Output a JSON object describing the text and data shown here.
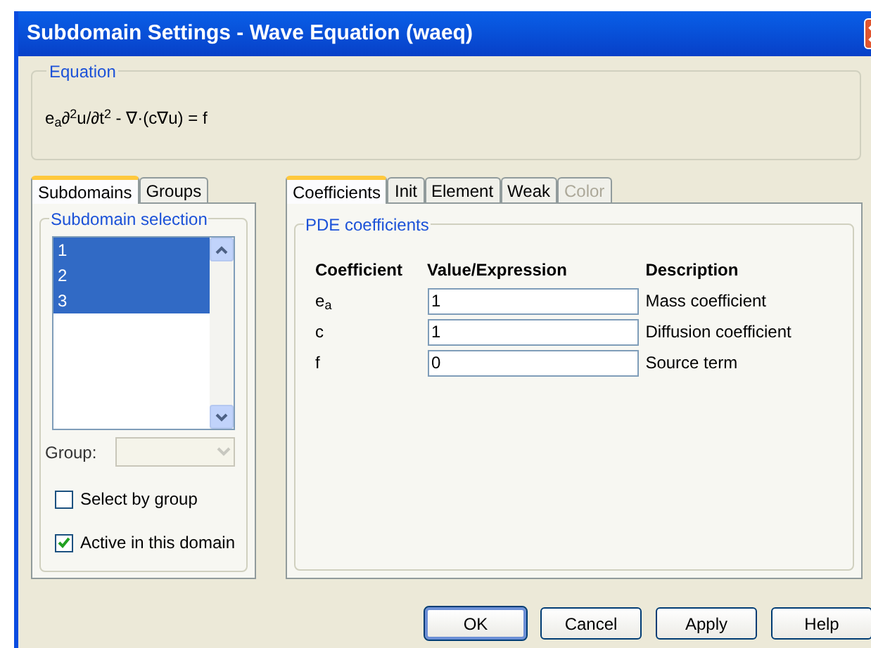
{
  "window": {
    "title": "Subdomain Settings - Wave Equation (waeq)"
  },
  "equation": {
    "label": "Equation",
    "text": "e$_{a}$∂$^{2}$u/∂t$^{2}$ - ∇·(c∇u) = f"
  },
  "left_tabs": [
    {
      "label": "Subdomains",
      "selected": true
    },
    {
      "label": "Groups",
      "selected": false
    }
  ],
  "subdomain_selection": {
    "label": "Subdomain selection",
    "items": [
      {
        "label": "1",
        "selected": true
      },
      {
        "label": "2",
        "selected": true
      },
      {
        "label": "3",
        "selected": true
      }
    ]
  },
  "group": {
    "label": "Group:",
    "disabled": true
  },
  "checkboxes": [
    {
      "label": "Select by group",
      "checked": false
    },
    {
      "label": "Active in this domain",
      "checked": true
    }
  ],
  "right_tabs": [
    {
      "label": "Coefficients",
      "selected": true,
      "disabled": false
    },
    {
      "label": "Init",
      "selected": false,
      "disabled": false
    },
    {
      "label": "Element",
      "selected": false,
      "disabled": false
    },
    {
      "label": "Weak",
      "selected": false,
      "disabled": false
    },
    {
      "label": "Color",
      "selected": false,
      "disabled": true
    }
  ],
  "pde_coefficients": {
    "label": "PDE coefficients",
    "columns": [
      "Coefficient",
      "Value/Expression",
      "Description"
    ],
    "rows": [
      {
        "coefficient": "e$_{a}$",
        "value": "1",
        "description": "Mass coefficient"
      },
      {
        "coefficient": "c",
        "value": "1",
        "description": "Diffusion coefficient"
      },
      {
        "coefficient": "f",
        "value": "0",
        "description": "Source term"
      }
    ]
  },
  "buttons": [
    {
      "label": "OK",
      "default": true
    },
    {
      "label": "Cancel",
      "default": false
    },
    {
      "label": "Apply",
      "default": false
    },
    {
      "label": "Help",
      "default": false
    }
  ]
}
